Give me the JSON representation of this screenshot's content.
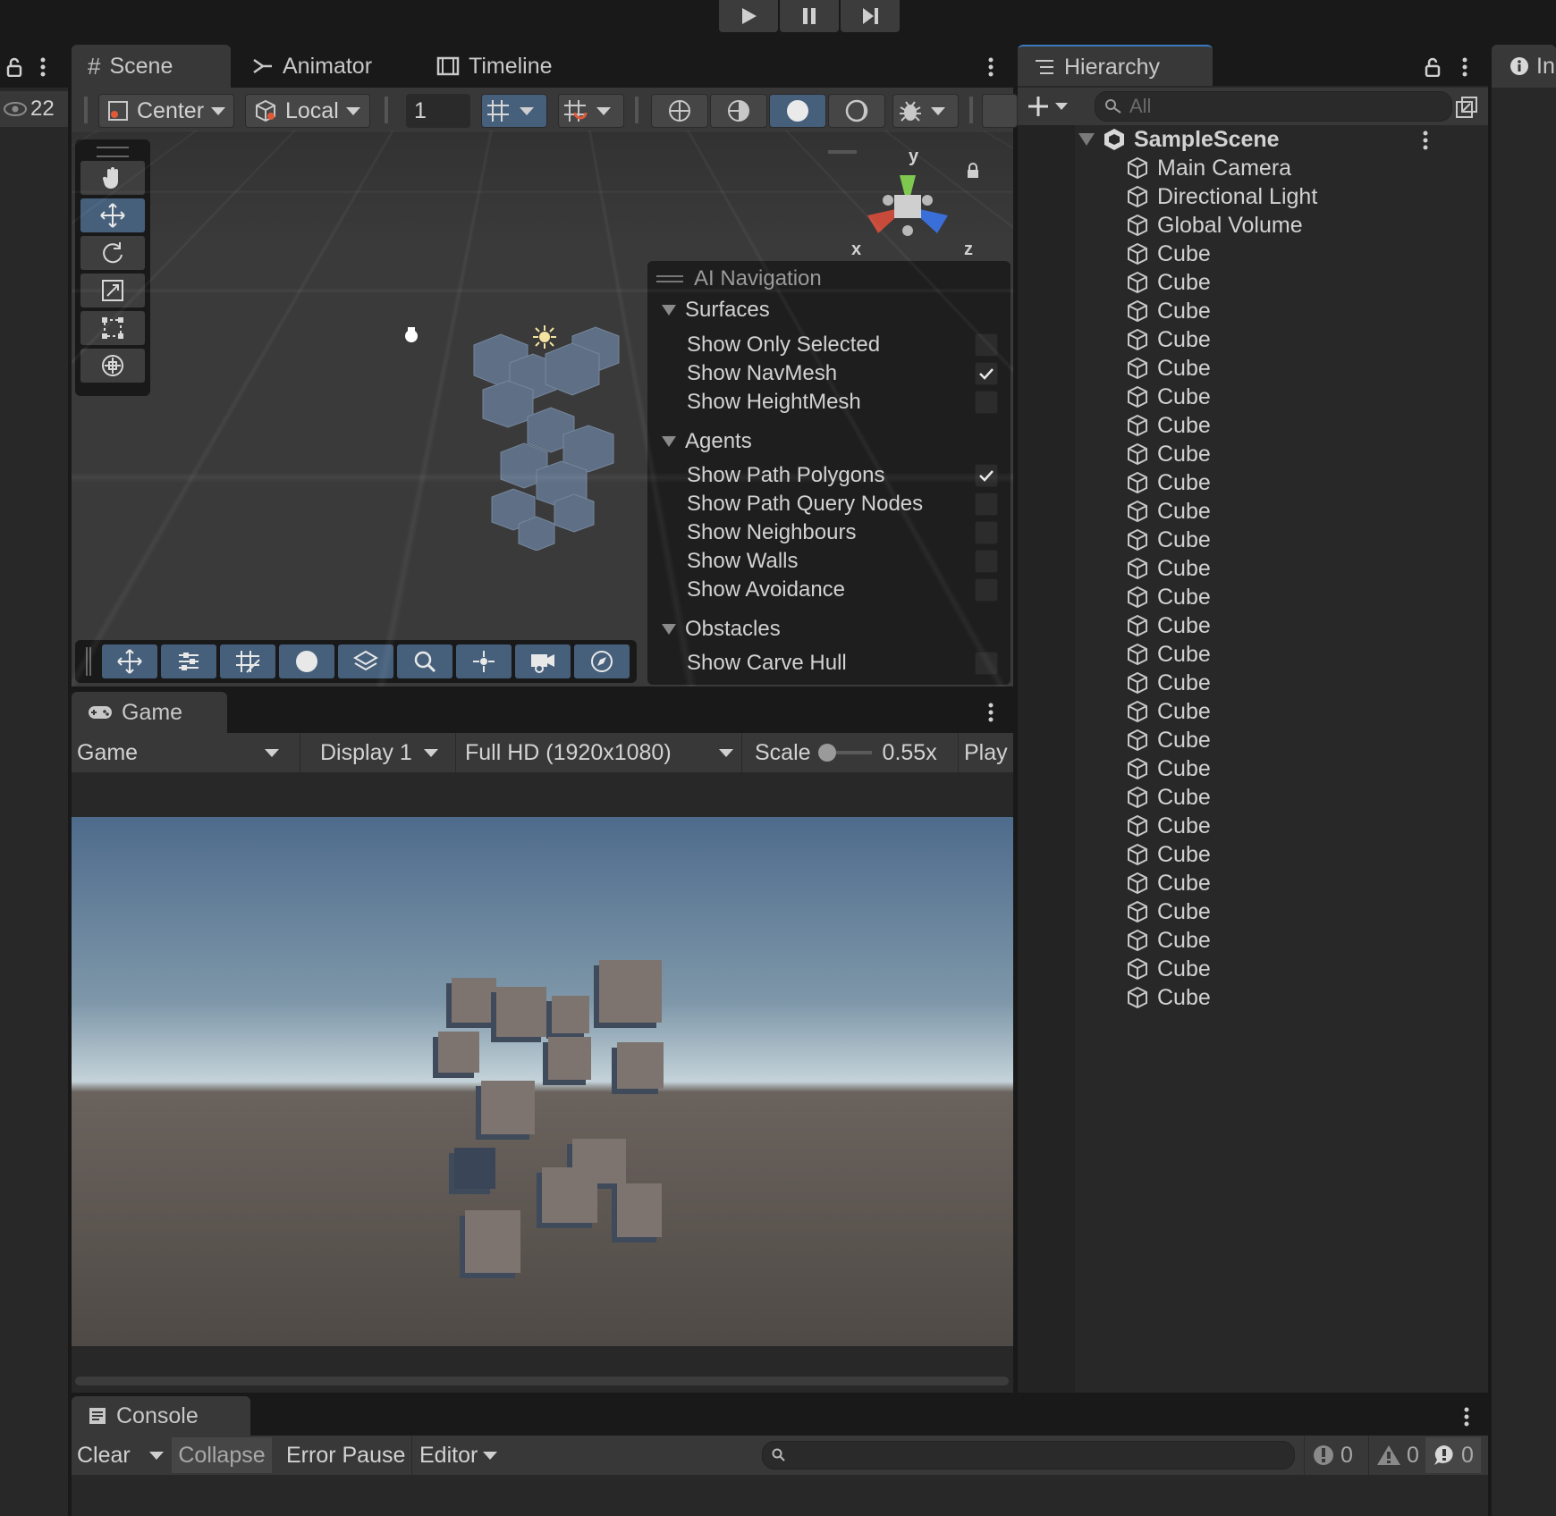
{
  "play_controls": [
    "play-icon",
    "pause-icon",
    "step-icon"
  ],
  "left_strip": {
    "visibility_count": "22"
  },
  "scene_tabs": [
    {
      "label": "Scene",
      "icon": "grid-icon"
    },
    {
      "label": "Animator",
      "icon": "animator-icon"
    },
    {
      "label": "Timeline",
      "icon": "timeline-icon"
    }
  ],
  "scene_toolbar": {
    "pivot": "Center",
    "space": "Local",
    "grid_size": "1"
  },
  "gizmo": {
    "y": "y",
    "x": "x",
    "z": "z"
  },
  "ai_navigation": {
    "title": "AI Navigation",
    "sections": [
      {
        "name": "Surfaces",
        "items": [
          {
            "label": "Show Only Selected",
            "checked": false
          },
          {
            "label": "Show NavMesh",
            "checked": true
          },
          {
            "label": "Show HeightMesh",
            "checked": false
          }
        ]
      },
      {
        "name": "Agents",
        "items": [
          {
            "label": "Show Path Polygons",
            "checked": true
          },
          {
            "label": "Show Path Query Nodes",
            "checked": false
          },
          {
            "label": "Show Neighbours",
            "checked": false
          },
          {
            "label": "Show Walls",
            "checked": false
          },
          {
            "label": "Show Avoidance",
            "checked": false
          }
        ]
      },
      {
        "name": "Obstacles",
        "items": [
          {
            "label": "Show Carve Hull",
            "checked": false
          }
        ]
      }
    ]
  },
  "game": {
    "tab": "Game",
    "mode": "Game",
    "display": "Display 1",
    "resolution": "Full HD (1920x1080)",
    "scale_label": "Scale",
    "scale_value": "0.55x",
    "play_focused": "Play Focuse"
  },
  "hierarchy": {
    "tab": "Hierarchy",
    "search_placeholder": "All",
    "scene": "SampleScene",
    "items": [
      "Main Camera",
      "Directional Light",
      "Global Volume",
      "Cube",
      "Cube",
      "Cube",
      "Cube",
      "Cube",
      "Cube",
      "Cube",
      "Cube",
      "Cube",
      "Cube",
      "Cube",
      "Cube",
      "Cube",
      "Cube",
      "Cube",
      "Cube",
      "Cube",
      "Cube",
      "Cube",
      "Cube",
      "Cube",
      "Cube",
      "Cube",
      "Cube",
      "Cube",
      "Cube",
      "Cube"
    ]
  },
  "inspector_tab": "In",
  "console": {
    "tab": "Console",
    "clear": "Clear",
    "collapse": "Collapse",
    "error_pause": "Error Pause",
    "editor": "Editor",
    "errors": "0",
    "warnings": "0",
    "messages": "0"
  },
  "colors": {
    "accent_blue": "#46607c",
    "panel": "#383838",
    "dark": "#191919"
  }
}
